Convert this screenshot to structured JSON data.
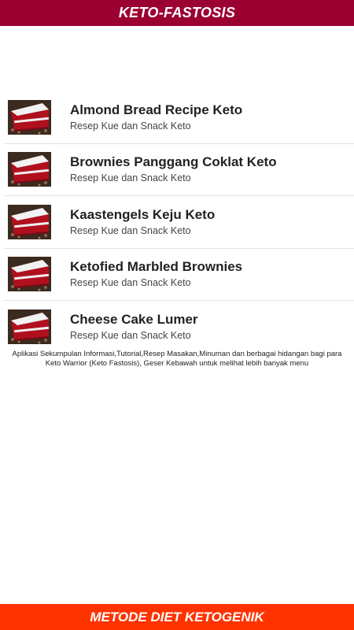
{
  "header": {
    "title": "KETO-FASTOSIS"
  },
  "list": {
    "items": [
      {
        "title": "Almond Bread Recipe Keto",
        "subtitle": "Resep Kue dan Snack Keto",
        "icon": "red-velvet-cake-thumbnail"
      },
      {
        "title": "Brownies Panggang Coklat Keto",
        "subtitle": "Resep Kue dan Snack Keto",
        "icon": "red-velvet-cake-thumbnail"
      },
      {
        "title": "Kaastengels Keju Keto",
        "subtitle": "Resep Kue dan Snack Keto",
        "icon": "red-velvet-cake-thumbnail"
      },
      {
        "title": "Ketofied Marbled Brownies",
        "subtitle": "Resep Kue dan Snack Keto",
        "icon": "red-velvet-cake-thumbnail"
      },
      {
        "title": "Cheese Cake Lumer",
        "subtitle": "Resep Kue dan Snack Keto",
        "icon": "red-velvet-cake-thumbnail"
      }
    ]
  },
  "description": "Aplikasi Sekumpulan Informasi,Tutorial,Resep Masakan,Minuman dan berbagai hidangan bagi para Keto Warrior (Keto Fastosis), Geser Kebawah untuk melihat lebih banyak menu",
  "footer": {
    "label": "METODE DIET KETOGENIK"
  },
  "colors": {
    "header_bg": "#9b0033",
    "footer_bg": "#ff3300",
    "text": "#222222"
  }
}
